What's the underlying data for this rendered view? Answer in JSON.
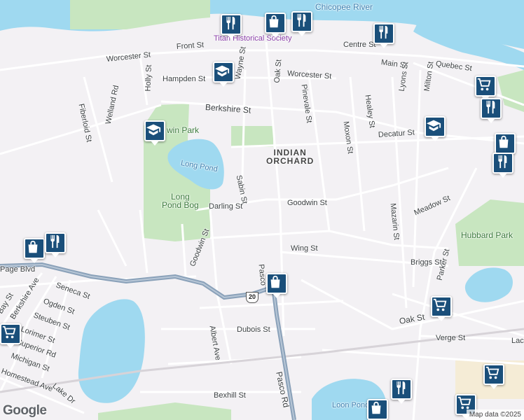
{
  "colors": {
    "land": "#f3f1f4",
    "water": "#9fd9f0",
    "park": "#c8e6c0",
    "road": "#ffffff",
    "highway": "#8aa1b9",
    "marker": "#1a4f7a"
  },
  "places": {
    "river": "Chicopee River",
    "neighborhood_line1": "INDIAN",
    "neighborhood_line2": "ORCHARD",
    "long_pond": "Long Pond",
    "long_pond_bog_line1": "Long",
    "long_pond_bog_line2": "Pond Bog",
    "park": "win Park",
    "hubbard_park": "Hubbard Park",
    "loon_pond": "Loon Pond",
    "historical_society": "Titan Historical Society"
  },
  "streets": {
    "worcester1": "Worcester St",
    "front": "Front St",
    "main": "Main St",
    "centre": "Centre St",
    "quebec": "Quebec St",
    "worcester2": "Worcester St",
    "hampden": "Hampden St",
    "holly": "Holly St",
    "berkshire": "Berkshire St",
    "fiberloid": "Fiberloid St",
    "welland": "Welland Rd",
    "oak1": "Oak St",
    "pinevale": "Pinevale St",
    "moxon": "Moxon St",
    "healey": "Healey St",
    "lyons": "Lyons St",
    "milton": "Milton St",
    "decatur": "Decatur St",
    "sabin": "Sabin St",
    "darling": "Darling St",
    "goodwin1": "Goodwin St",
    "meadow": "Meadow St",
    "mazarin": "Mazarin St",
    "wing": "Wing St",
    "goodwin2": "Goodwin St",
    "pasco1": "Pasco",
    "briggs": "Briggs St",
    "parker": "Parker St",
    "page": "Page Blvd",
    "seneca": "Seneca St",
    "ogden": "Ogden St",
    "steuben": "Steuben St",
    "berkshire_ave": "Berkshire Ave",
    "lorimer": "Lorimer St",
    "superior": "Superior Rd",
    "michigan": "Michigan St",
    "homestead": "Homestead Ave",
    "lake": "Lake Dr",
    "albert": "Albert Ave",
    "dubois": "Dubois St",
    "oak2": "Oak St",
    "verge": "Verge St",
    "lac": "Lac",
    "pasco2": "Pasco Rd",
    "bexhill": "Bexhill St",
    "wayne": "Wayne St",
    "bay": "Bay St"
  },
  "route_shield": "20",
  "markers": [
    {
      "name": "restaurant-marker",
      "icon": "restaurant"
    },
    {
      "name": "shopping-marker",
      "icon": "shopping-bag"
    },
    {
      "name": "school-marker",
      "icon": "school"
    },
    {
      "name": "grocery-marker",
      "icon": "grocery-cart"
    }
  ],
  "footer": {
    "logo": "Google",
    "attribution": "Map data ©2025"
  }
}
